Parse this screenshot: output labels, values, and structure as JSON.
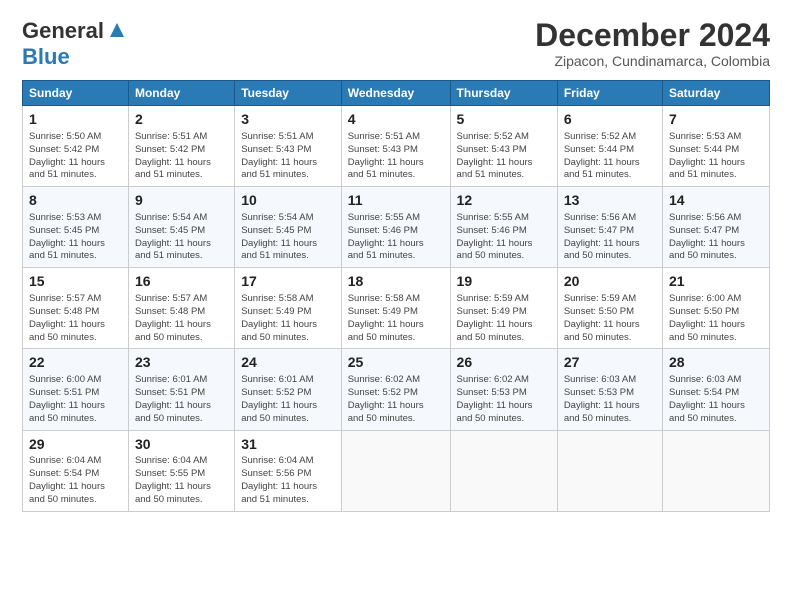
{
  "logo": {
    "line1": "General",
    "line2": "Blue"
  },
  "title": "December 2024",
  "subtitle": "Zipacon, Cundinamarca, Colombia",
  "days_of_week": [
    "Sunday",
    "Monday",
    "Tuesday",
    "Wednesday",
    "Thursday",
    "Friday",
    "Saturday"
  ],
  "weeks": [
    [
      {
        "day": "1",
        "info": "Sunrise: 5:50 AM\nSunset: 5:42 PM\nDaylight: 11 hours\nand 51 minutes."
      },
      {
        "day": "2",
        "info": "Sunrise: 5:51 AM\nSunset: 5:42 PM\nDaylight: 11 hours\nand 51 minutes."
      },
      {
        "day": "3",
        "info": "Sunrise: 5:51 AM\nSunset: 5:43 PM\nDaylight: 11 hours\nand 51 minutes."
      },
      {
        "day": "4",
        "info": "Sunrise: 5:51 AM\nSunset: 5:43 PM\nDaylight: 11 hours\nand 51 minutes."
      },
      {
        "day": "5",
        "info": "Sunrise: 5:52 AM\nSunset: 5:43 PM\nDaylight: 11 hours\nand 51 minutes."
      },
      {
        "day": "6",
        "info": "Sunrise: 5:52 AM\nSunset: 5:44 PM\nDaylight: 11 hours\nand 51 minutes."
      },
      {
        "day": "7",
        "info": "Sunrise: 5:53 AM\nSunset: 5:44 PM\nDaylight: 11 hours\nand 51 minutes."
      }
    ],
    [
      {
        "day": "8",
        "info": "Sunrise: 5:53 AM\nSunset: 5:45 PM\nDaylight: 11 hours\nand 51 minutes."
      },
      {
        "day": "9",
        "info": "Sunrise: 5:54 AM\nSunset: 5:45 PM\nDaylight: 11 hours\nand 51 minutes."
      },
      {
        "day": "10",
        "info": "Sunrise: 5:54 AM\nSunset: 5:45 PM\nDaylight: 11 hours\nand 51 minutes."
      },
      {
        "day": "11",
        "info": "Sunrise: 5:55 AM\nSunset: 5:46 PM\nDaylight: 11 hours\nand 51 minutes."
      },
      {
        "day": "12",
        "info": "Sunrise: 5:55 AM\nSunset: 5:46 PM\nDaylight: 11 hours\nand 50 minutes."
      },
      {
        "day": "13",
        "info": "Sunrise: 5:56 AM\nSunset: 5:47 PM\nDaylight: 11 hours\nand 50 minutes."
      },
      {
        "day": "14",
        "info": "Sunrise: 5:56 AM\nSunset: 5:47 PM\nDaylight: 11 hours\nand 50 minutes."
      }
    ],
    [
      {
        "day": "15",
        "info": "Sunrise: 5:57 AM\nSunset: 5:48 PM\nDaylight: 11 hours\nand 50 minutes."
      },
      {
        "day": "16",
        "info": "Sunrise: 5:57 AM\nSunset: 5:48 PM\nDaylight: 11 hours\nand 50 minutes."
      },
      {
        "day": "17",
        "info": "Sunrise: 5:58 AM\nSunset: 5:49 PM\nDaylight: 11 hours\nand 50 minutes."
      },
      {
        "day": "18",
        "info": "Sunrise: 5:58 AM\nSunset: 5:49 PM\nDaylight: 11 hours\nand 50 minutes."
      },
      {
        "day": "19",
        "info": "Sunrise: 5:59 AM\nSunset: 5:49 PM\nDaylight: 11 hours\nand 50 minutes."
      },
      {
        "day": "20",
        "info": "Sunrise: 5:59 AM\nSunset: 5:50 PM\nDaylight: 11 hours\nand 50 minutes."
      },
      {
        "day": "21",
        "info": "Sunrise: 6:00 AM\nSunset: 5:50 PM\nDaylight: 11 hours\nand 50 minutes."
      }
    ],
    [
      {
        "day": "22",
        "info": "Sunrise: 6:00 AM\nSunset: 5:51 PM\nDaylight: 11 hours\nand 50 minutes."
      },
      {
        "day": "23",
        "info": "Sunrise: 6:01 AM\nSunset: 5:51 PM\nDaylight: 11 hours\nand 50 minutes."
      },
      {
        "day": "24",
        "info": "Sunrise: 6:01 AM\nSunset: 5:52 PM\nDaylight: 11 hours\nand 50 minutes."
      },
      {
        "day": "25",
        "info": "Sunrise: 6:02 AM\nSunset: 5:52 PM\nDaylight: 11 hours\nand 50 minutes."
      },
      {
        "day": "26",
        "info": "Sunrise: 6:02 AM\nSunset: 5:53 PM\nDaylight: 11 hours\nand 50 minutes."
      },
      {
        "day": "27",
        "info": "Sunrise: 6:03 AM\nSunset: 5:53 PM\nDaylight: 11 hours\nand 50 minutes."
      },
      {
        "day": "28",
        "info": "Sunrise: 6:03 AM\nSunset: 5:54 PM\nDaylight: 11 hours\nand 50 minutes."
      }
    ],
    [
      {
        "day": "29",
        "info": "Sunrise: 6:04 AM\nSunset: 5:54 PM\nDaylight: 11 hours\nand 50 minutes."
      },
      {
        "day": "30",
        "info": "Sunrise: 6:04 AM\nSunset: 5:55 PM\nDaylight: 11 hours\nand 50 minutes."
      },
      {
        "day": "31",
        "info": "Sunrise: 6:04 AM\nSunset: 5:56 PM\nDaylight: 11 hours\nand 51 minutes."
      },
      {
        "day": "",
        "info": ""
      },
      {
        "day": "",
        "info": ""
      },
      {
        "day": "",
        "info": ""
      },
      {
        "day": "",
        "info": ""
      }
    ]
  ]
}
